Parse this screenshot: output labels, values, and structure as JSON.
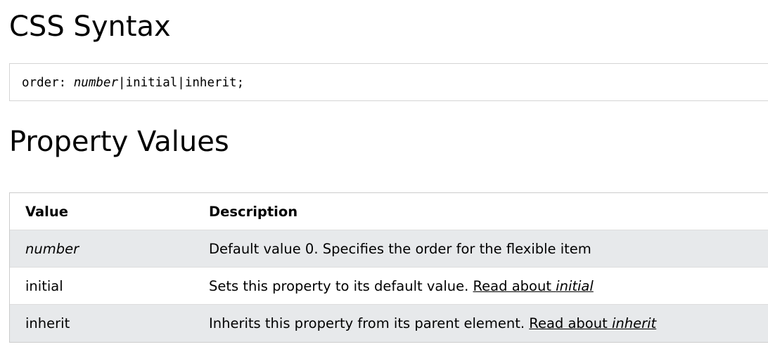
{
  "headings": {
    "syntax": "CSS Syntax",
    "values": "Property Values"
  },
  "syntax": {
    "prefix": "order: ",
    "value": "number",
    "sep1": "|",
    "initial": "initial",
    "sep2": "|",
    "inherit": "inherit",
    "suffix": ";"
  },
  "table": {
    "headers": {
      "value": "Value",
      "description": "Description"
    },
    "rows": [
      {
        "value": "number",
        "description": "Default value 0. Specifies the order for the flexible item",
        "link_prefix": "",
        "link_term": ""
      },
      {
        "value": "initial",
        "description": "Sets this property to its default value. ",
        "link_prefix": "Read about ",
        "link_term": "initial"
      },
      {
        "value": "inherit",
        "description": "Inherits this property from its parent element. ",
        "link_prefix": "Read about ",
        "link_term": "inherit"
      }
    ]
  }
}
